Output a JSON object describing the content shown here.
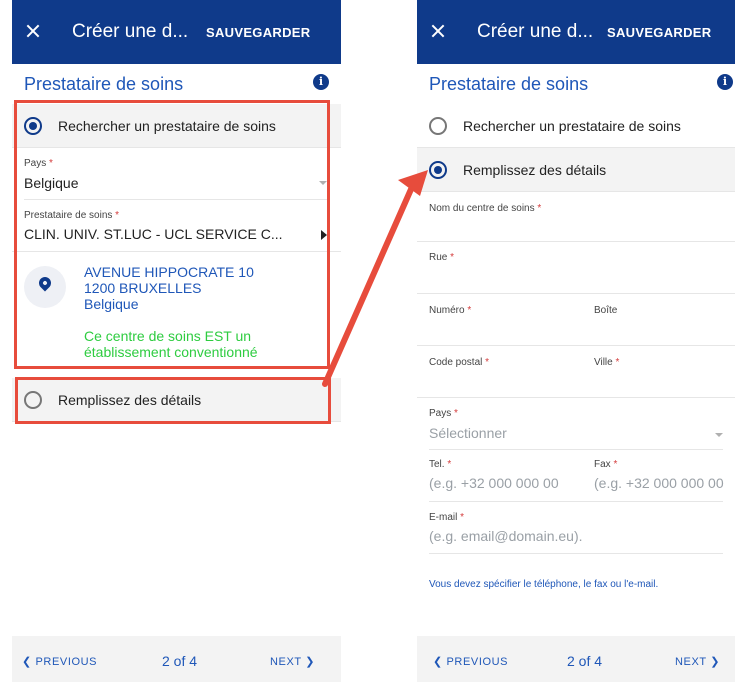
{
  "colors": {
    "appbar": "#0f3a8a",
    "accent": "#1f57b8",
    "highlight": "#e74c3c",
    "success": "#2ecc40",
    "required": "#d43b3b"
  },
  "left": {
    "title": "Créer une d...",
    "save": "SAUVEGARDER",
    "section": "Prestataire de soins",
    "info_icon": "info-icon",
    "option_search": "Rechercher un prestataire de soins",
    "pays_label": "Pays",
    "pays_value": "Belgique",
    "provider_label": "Prestataire de soins",
    "provider_value": "CLIN. UNIV. ST.LUC - UCL SERVICE C...",
    "address": {
      "line1": "AVENUE HIPPOCRATE 10",
      "line2": "1200 BRUXELLES",
      "line3": "Belgique"
    },
    "conventionne": {
      "line1": "Ce centre de soins EST un",
      "line2": "établissement conventionné"
    },
    "option_details": "Remplissez des détails",
    "footer": {
      "prev": "❮ PREVIOUS",
      "pager": "2 of 4",
      "next": "NEXT ❯"
    }
  },
  "right": {
    "title": "Créer une d...",
    "save": "SAUVEGARDER",
    "section": "Prestataire de soins",
    "option_search": "Rechercher un prestataire de soins",
    "option_details": "Remplissez des détails",
    "fields": {
      "centre": "Nom du centre de soins",
      "rue": "Rue",
      "numero": "Numéro",
      "boite": "Boîte",
      "code_postal": "Code postal",
      "ville": "Ville",
      "pays": "Pays",
      "pays_placeholder": "Sélectionner",
      "tel": "Tel.",
      "tel_placeholder": "(e.g. +32 000 000 00",
      "fax": "Fax",
      "fax_placeholder": "(e.g. +32 000 000 00",
      "email": "E-mail",
      "email_placeholder": "(e.g. email@domain.eu)."
    },
    "note": "Vous devez spécifier le téléphone, le fax ou l'e-mail.",
    "footer": {
      "prev": "❮ PREVIOUS",
      "pager": "2 of 4",
      "next": "NEXT ❯"
    }
  }
}
